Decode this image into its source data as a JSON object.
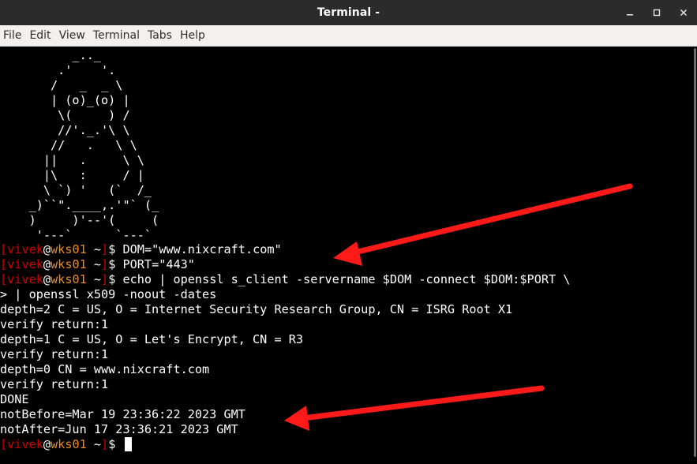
{
  "window": {
    "title": "Terminal -",
    "buttons": [
      "minimize",
      "maximize",
      "close"
    ]
  },
  "menu": [
    "File",
    "Edit",
    "View",
    "Terminal",
    "Tabs",
    "Help"
  ],
  "ascii_art": [
    "          _.._",
    "        .'    '.",
    "       /   _  _ \\",
    "       | (o)_(o) |",
    "        \\(     ) /",
    "        //'._.'\\ \\",
    "       //   .   \\ \\",
    "      ||   .     \\ \\",
    "      |\\   :     / |",
    "      \\ `) '   (`  /_",
    "    _)``\".____,.'\"` (_",
    "    )     )'--'(     (",
    "     '---`      `---`"
  ],
  "prompt": {
    "open": "[",
    "user": "vivek",
    "at": "@",
    "host": "wks01",
    "path": " ~",
    "close": "]",
    "symbol": "$ "
  },
  "commands": [
    "DOM=\"www.nixcraft.com\"",
    "PORT=\"443\"",
    "echo | openssl s_client -servername $DOM -connect $DOM:$PORT \\"
  ],
  "continuation": "> | openssl x509 -noout -dates",
  "output": [
    "depth=2 C = US, O = Internet Security Research Group, CN = ISRG Root X1",
    "verify return:1",
    "depth=1 C = US, O = Let's Encrypt, CN = R3",
    "verify return:1",
    "depth=0 CN = www.nixcraft.com",
    "verify return:1",
    "DONE",
    "notBefore=Mar 19 23:36:22 2023 GMT",
    "notAfter=Jun 17 23:36:21 2023 GMT"
  ],
  "colors": {
    "bracket": "#cc0000",
    "user": "#cc0000",
    "host": "#f08a24",
    "annotation_arrow": "#ff1a1a"
  }
}
